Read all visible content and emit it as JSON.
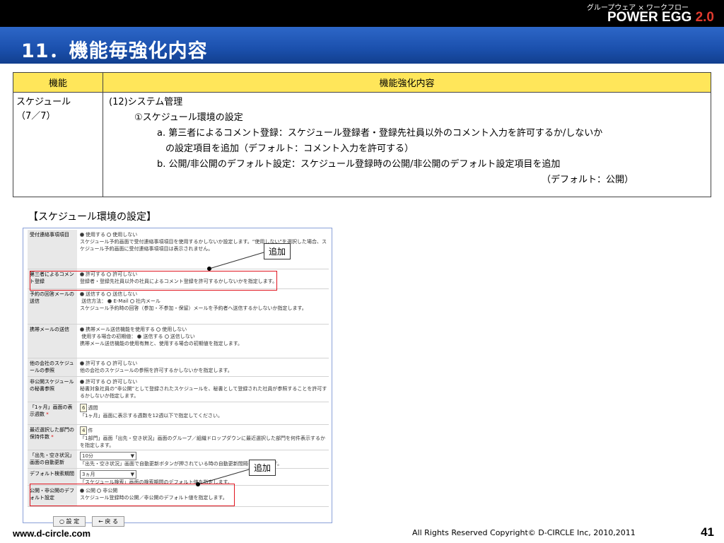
{
  "header": {
    "subtitle": "グループウェア × ワークフロー",
    "brand": "POWER EGG",
    "version": "2.0",
    "title": "11．機能毎強化内容"
  },
  "table": {
    "headers": [
      "機能",
      "機能強化内容"
    ],
    "row": {
      "function": [
        "スケジュール",
        "（7／7）"
      ],
      "lines": [
        "(12)システム管理",
        "①スケジュール環境の設定",
        "a. 第三者によるコメント登録：スケジュール登録者・登録先社員以外のコメント入力を許可するか/しないか",
        "の設定項目を追加（デフォルト：コメント入力を許可する）",
        "b. 公開/非公開のデフォルト設定：スケジュール登録時の公開/非公開のデフォルト設定項目を追加",
        "（デフォルト：公開）"
      ]
    }
  },
  "caption": "【スケジュール環境の設定】",
  "screenshot": {
    "rows": [
      {
        "label": "受付連絡事項項目",
        "options": [
          "使用する",
          "使用しない"
        ],
        "desc": "スケジュール予約画面で受付連絡事項項目を使用するかしないか設定します。“使用しない”を選択した場合、スケジュール予約画面に受付連絡事項項目は表示されません。"
      },
      {
        "label": "第三者によるコメント登録",
        "options": [
          "許可する",
          "許可しない"
        ],
        "desc": "登録者・登録先社員以外の社員によるコメント登録を許可するかしないかを指定します。"
      },
      {
        "label": "予約の回答メールの送信",
        "options": [
          "送信する",
          "送信しない"
        ],
        "sub": "送信方法：",
        "sub_options": [
          "E-Mail",
          "社内メール"
        ],
        "desc": "スケジュール予約時の回答（参加・不参加・保留）メールを予約者へ送信するかしないか指定します。"
      },
      {
        "label": "携帯メールの送信",
        "options": [
          "携帯メール送信機能を使用する",
          "使用しない"
        ],
        "sub": "使用する場合の初期値：",
        "sub_options": [
          "送信する",
          "送信しない"
        ],
        "desc": "携帯メール送信機能の使用有無と、使用する場合の初期値を指定します。"
      },
      {
        "label": "他の会社のスケジュールの参照",
        "options": [
          "許可する",
          "許可しない"
        ],
        "desc": "他の会社のスケジュールの参照を許可するかしないかを指定します。"
      },
      {
        "label": "非公開スケジュールの秘書参照",
        "options": [
          "許可する",
          "許可しない"
        ],
        "desc": "秘書対象社員の“非公開”として登録されたスケジュールを、秘書として登録された社員が参照することを許可するかしないか指定します。"
      },
      {
        "label": "「1ヶ月」画面の表示週数",
        "required": "*",
        "input": "6",
        "unit": "週間",
        "desc": "「1ヶ月」画面に表示する週数を12週以下で指定してください。"
      },
      {
        "label": "最近選択した部門の保持件数",
        "required": "*",
        "input": "4",
        "unit": "件",
        "desc": "「1部門」画面「出先・空き状況」画面のグループ／組織ドロップダウンに最近選択した部門を何件表示するかを指定します。"
      },
      {
        "label": "「出先・空き状況」画面の自動更新",
        "select": "10分",
        "desc": "「出先・空き状況」画面で自動更新ボタンが押されている時の自動更新間隔を指定します。"
      },
      {
        "label": "デフォルト検索期間",
        "select": "3ヵ月",
        "desc": "「スケジュール検索」画面の検索期間のデフォルト値を指定します。"
      },
      {
        "label": "公開・非公開のデフォルト設定",
        "options": [
          "公開",
          "非公開"
        ],
        "desc": "スケジュール登録時の公開／非公開のデフォルト値を指定します。"
      }
    ],
    "buttons": [
      "設 定",
      "戻 る"
    ]
  },
  "callouts": [
    "追加",
    "追加"
  ],
  "footer": {
    "url": "www.d-circle.com",
    "copyright": "All Rights Reserved Copyright© D-CIRCLE  Inc, 2010,2011",
    "page": "41"
  }
}
